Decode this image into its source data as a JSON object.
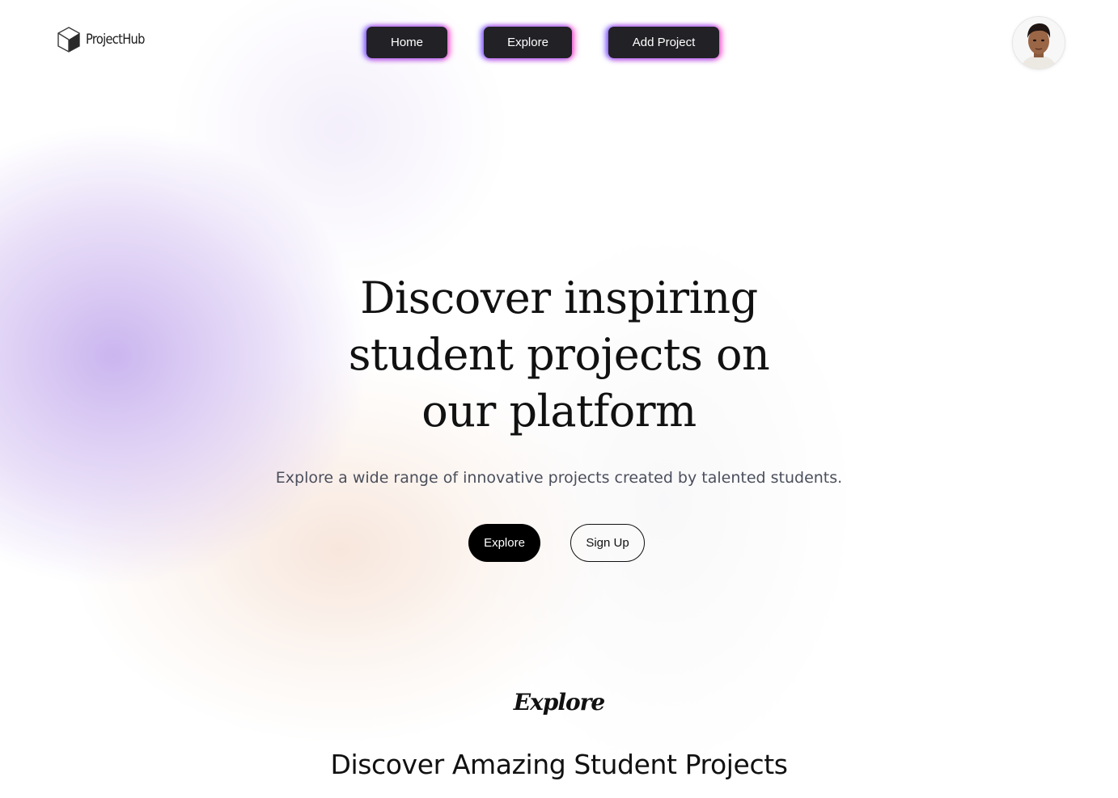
{
  "header": {
    "logo_text": "ProjectHub",
    "logo_icon": "cube-icon",
    "nav": [
      {
        "label": "Home"
      },
      {
        "label": "Explore"
      },
      {
        "label": "Add Project"
      }
    ],
    "avatar_icon": "user-avatar"
  },
  "hero": {
    "title_lines": [
      "Discover inspiring",
      "student projects on",
      "our platform"
    ],
    "subtitle": "Explore a wide range of innovative projects created by talented students.",
    "primary_button": "Explore",
    "secondary_button": "Sign Up"
  },
  "explore_section": {
    "script_label": "Explore",
    "heading": "Discover Amazing Student Projects"
  },
  "colors": {
    "nav_button_bg": "#212126",
    "nav_glow_left": "#6e50ff",
    "nav_glow_right": "#ff5ac8",
    "primary_button_bg": "#000000",
    "subtitle_text": "#4b4f5c",
    "blob_purple": "#c8b2ee",
    "blob_peach": "#f6e2d6"
  }
}
